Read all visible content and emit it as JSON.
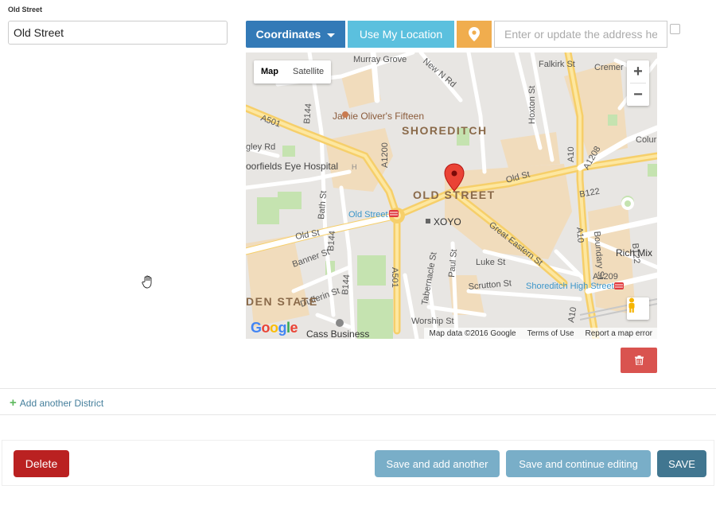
{
  "field": {
    "label": "Old Street",
    "value": "Old Street"
  },
  "toolbar": {
    "coordinates_label": "Coordinates",
    "use_location_label": "Use My Location",
    "address_placeholder": "Enter or update the address here"
  },
  "map": {
    "type_map": "Map",
    "type_satellite": "Satellite",
    "zoom_in": "+",
    "zoom_out": "−",
    "labels": {
      "murray_grove": "Murray Grove",
      "new_n_rd": "New N Rd",
      "falkirk_st": "Falkirk St",
      "cremer": "Cremer",
      "a501": "A501",
      "b144": "B144",
      "jamie_olivers": "Jamie Oliver's Fifteen",
      "shoreditch": "SHOREDITCH",
      "gley_rd": "gley Rd",
      "moorfields": "oorfields Eye Hospital",
      "old_street_area": "OLD STREET",
      "old_st_east": "Old St",
      "b122": "B122",
      "a1208": "A1208",
      "colum": "Colur",
      "old_street_station": "Old Street",
      "xoyo": "XOYO",
      "old_st_west": "Old St",
      "bath_st": "Bath St",
      "banner_st": "Banner St",
      "great_eastern": "Great Eastern St",
      "luke_st": "Luke St",
      "rich_mix": "Rich Mix",
      "a1209": "A1209",
      "shoreditch_high_street": "Shoreditch High Street",
      "dufferin": "Dufferin St",
      "scrutton": "Scrutton St",
      "den_state": "DEN STATE",
      "worship_st": "Worship St",
      "cass_business": "Cass Business",
      "tabernacle": "Tabernacle St",
      "paul_st": "Paul St",
      "hoxton_st": "Hoxton St",
      "boundary_st": "Boundary St",
      "a10": "A10",
      "a1200": "A1200",
      "h_symbol": "H"
    },
    "attribution": {
      "map_data": "Map data ©2016 Google",
      "terms": "Terms of Use",
      "report": "Report a map error"
    },
    "logo": "Google"
  },
  "inline": {
    "add_another": "Add another District"
  },
  "submit": {
    "delete": "Delete",
    "save_add_another": "Save and add another",
    "save_continue": "Save and continue editing",
    "save": "SAVE"
  },
  "colors": {
    "coordinates": "#337ab7",
    "use_location": "#5bc0de",
    "pin": "#f0ad4e",
    "trash": "#d9534f",
    "delete": "#ba2121",
    "save_light": "#79aec8",
    "save": "#417690"
  }
}
